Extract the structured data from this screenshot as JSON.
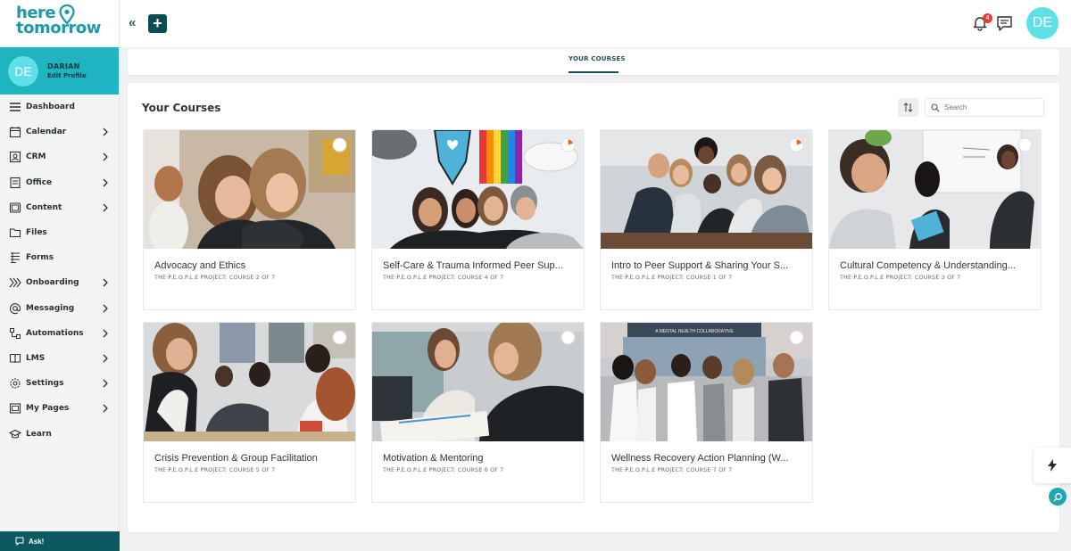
{
  "brand": {
    "line1": "here",
    "line2": "tomorrow"
  },
  "profile": {
    "initials": "DE",
    "name": "DARIAN",
    "edit": "Edit Profile"
  },
  "sidebar": {
    "items": [
      {
        "label": "Dashboard",
        "icon": "menu-icon",
        "has_children": false
      },
      {
        "label": "Calendar",
        "icon": "calendar-icon",
        "has_children": true
      },
      {
        "label": "CRM",
        "icon": "contact-icon",
        "has_children": true
      },
      {
        "label": "Office",
        "icon": "office-icon",
        "has_children": true
      },
      {
        "label": "Content",
        "icon": "content-icon",
        "has_children": true
      },
      {
        "label": "Files",
        "icon": "folder-icon",
        "has_children": false
      },
      {
        "label": "Forms",
        "icon": "forms-icon",
        "has_children": false
      },
      {
        "label": "Onboarding",
        "icon": "onboarding-icon",
        "has_children": true
      },
      {
        "label": "Messaging",
        "icon": "at-icon",
        "has_children": true
      },
      {
        "label": "Automations",
        "icon": "automation-icon",
        "has_children": true
      },
      {
        "label": "LMS",
        "icon": "book-icon",
        "has_children": true
      },
      {
        "label": "Settings",
        "icon": "gear-icon",
        "has_children": true
      },
      {
        "label": "My Pages",
        "icon": "pages-icon",
        "has_children": true
      },
      {
        "label": "Learn",
        "icon": "graduation-icon",
        "has_children": false
      }
    ],
    "ask_label": "Ask!"
  },
  "topbar": {
    "collapse_glyph": "«",
    "add_glyph": "+",
    "notification_count": "4",
    "avatar_initials": "DE"
  },
  "tabs": {
    "active": "YOUR COURSES"
  },
  "courses_panel": {
    "title": "Your Courses",
    "search_placeholder": "Search",
    "courses": [
      {
        "title": "Advocacy and Ethics",
        "subtitle": "THE P.E.O.P.L.E PROJECT: COURSE 2 OF 7",
        "progress": 0
      },
      {
        "title": "Self-Care & Trauma Informed Peer Sup...",
        "subtitle": "THE P.E.O.P.L.E PROJECT: COURSE 4 OF 7",
        "progress": 0.2
      },
      {
        "title": "Intro to Peer Support & Sharing Your S...",
        "subtitle": "THE P.E.O.P.L.E PROJECT: COURSE 1 OF 7",
        "progress": 0.2
      },
      {
        "title": "Cultural Competency & Understanding...",
        "subtitle": "THE P.E.O.P.L.E PROJECT: COURSE 3 OF 7",
        "progress": 0
      },
      {
        "title": "Crisis Prevention & Group Facilitation",
        "subtitle": "THE P.E.O.P.L.E PROJECT: COURSE 5 OF 7",
        "progress": 0
      },
      {
        "title": "Motivation & Mentoring",
        "subtitle": "THE P.E.O.P.L.E PROJECT: COURSE 6 OF 7",
        "progress": 0
      },
      {
        "title": "Wellness Recovery Action Planning (W...",
        "subtitle": "THE P.E.O.P.L.E PROJECT: COURSE 7 OF 7",
        "progress": 0
      }
    ],
    "photo_signs": {
      "office": "A MENTAL HEALTH COLLABORATIVE"
    }
  },
  "colors": {
    "accent": "#1fb4bf",
    "brand_text": "#1e9aa6",
    "dark": "#0c4d52",
    "progress": "#e8692c",
    "badge": "#e53935"
  }
}
